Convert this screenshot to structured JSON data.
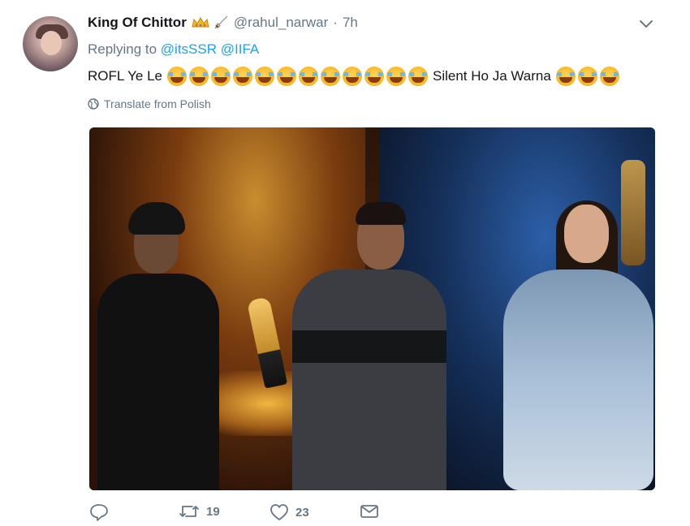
{
  "tweet": {
    "display_name": "King Of Chittor",
    "name_emojis": [
      "crown-icon",
      "dagger-icon"
    ],
    "handle": "@rahul_narwar",
    "separator": "·",
    "time": "7h",
    "replying_prefix": "Replying to",
    "replying_to": [
      "@itsSSR",
      "@IIFA"
    ],
    "text_before": "ROFL Ye Le",
    "text_middle": "Silent Ho Ja Warna",
    "emoji_first_count": 12,
    "emoji_last_count": 3,
    "emoji_name": "face-with-tears-of-joy",
    "translate_label": "Translate from Polish",
    "media_alt": "",
    "reply_count": "",
    "retweet_count": "19",
    "like_count": "23"
  },
  "colors": {
    "link": "#1da1f2",
    "secondary": "#657786",
    "primary": "#14171a"
  }
}
